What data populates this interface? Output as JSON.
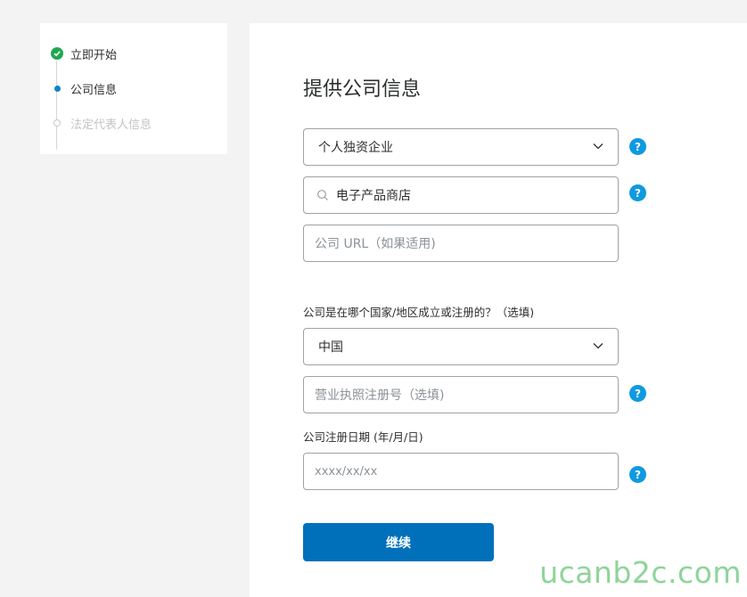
{
  "steps": [
    {
      "label": "立即开始",
      "state": "done"
    },
    {
      "label": "公司信息",
      "state": "active"
    },
    {
      "label": "法定代表人信息",
      "state": "pending"
    }
  ],
  "form": {
    "title": "提供公司信息",
    "business_type": "个人独资企业",
    "category": "电子产品商店",
    "url_placeholder": "公司 URL（如果适用)",
    "country_question": "公司是在哪个国家/地区成立或注册的？（选填)",
    "country": "中国",
    "license_placeholder": "营业执照注册号（选填)",
    "date_label": "公司注册日期 (年/月/日)",
    "date_placeholder": "xxxx/xx/xx",
    "help_glyph": "?",
    "continue_label": "继续"
  },
  "watermark": "ucanb2c.com",
  "colors": {
    "primary": "#0070ba",
    "help": "#0f9ae0",
    "done": "#1fa84f",
    "active": "#0f84c8"
  }
}
